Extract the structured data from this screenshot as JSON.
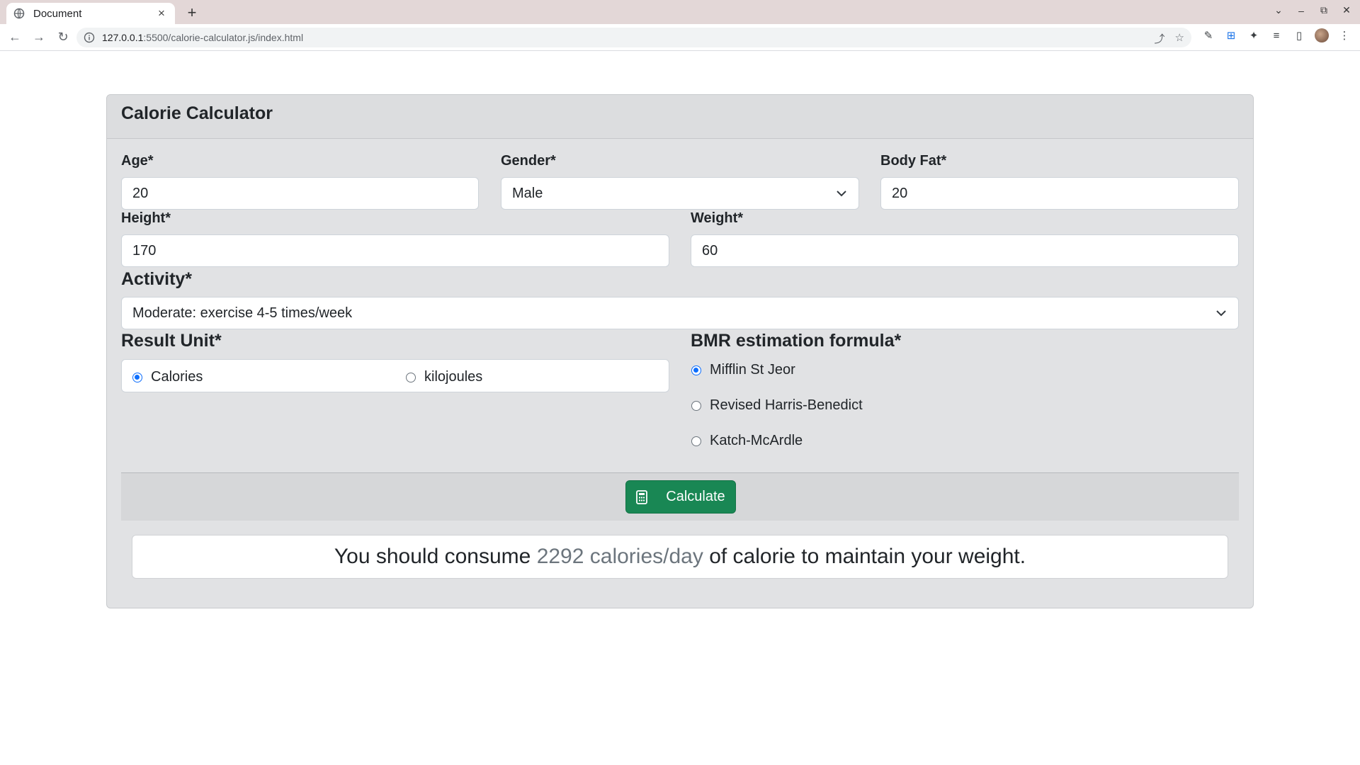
{
  "browser": {
    "tab_title": "Document",
    "new_tab": "+",
    "url_host": "127.0.0.1",
    "url_path": ":5500/calorie-calculator.js/index.html"
  },
  "card": {
    "title": "Calorie Calculator"
  },
  "form": {
    "age": {
      "label": "Age*",
      "value": "20"
    },
    "gender": {
      "label": "Gender*",
      "value": "Male"
    },
    "body_fat": {
      "label": "Body Fat*",
      "value": "20"
    },
    "height": {
      "label": "Height*",
      "value": "170"
    },
    "weight": {
      "label": "Weight*",
      "value": "60"
    },
    "activity": {
      "label": "Activity*",
      "value": "Moderate: exercise 4-5 times/week"
    },
    "result_unit": {
      "label": "Result Unit*",
      "options": [
        "Calories",
        "kilojoules"
      ],
      "selected": "Calories"
    },
    "bmr_formula": {
      "label": "BMR estimation formula*",
      "options": [
        "Mifflin St Jeor",
        "Revised Harris-Benedict",
        "Katch-McArdle"
      ],
      "selected": "Mifflin St Jeor"
    }
  },
  "actions": {
    "calculate_label": "Calculate"
  },
  "result": {
    "prefix": "You should consume",
    "value": "2292 calories/day",
    "suffix": "of calorie to maintain your weight."
  },
  "colors": {
    "button_green": "#198754",
    "radio_blue": "#0d6efd",
    "card_bg": "#e1e2e4"
  }
}
